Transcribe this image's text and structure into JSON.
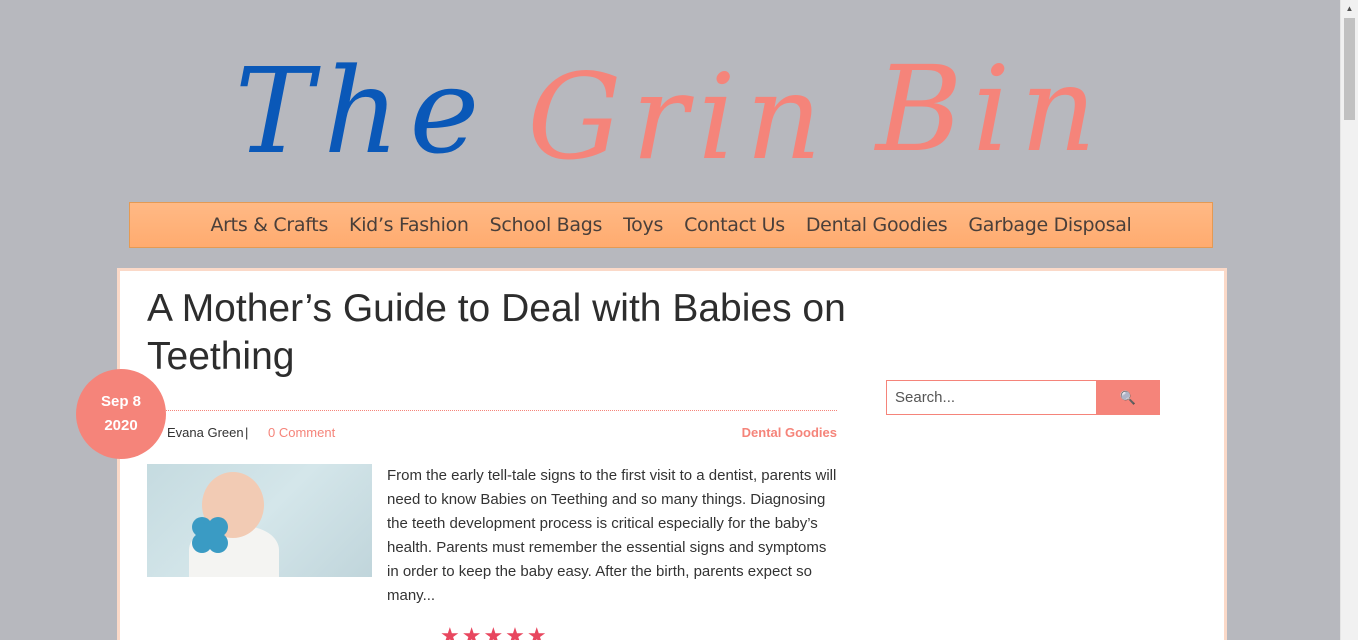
{
  "logo": {
    "word1": "The",
    "word2": "Grin",
    "word3": "Bin",
    "colors": {
      "primary": "#0a58b8",
      "accent": "#f5847a"
    }
  },
  "nav": {
    "items": [
      {
        "label": "Arts & Crafts"
      },
      {
        "label": "Kid’s Fashion"
      },
      {
        "label": "School Bags"
      },
      {
        "label": "Toys"
      },
      {
        "label": "Contact Us"
      },
      {
        "label": "Dental Goodies"
      },
      {
        "label": "Garbage Disposal"
      }
    ]
  },
  "post": {
    "title": "A Mother’s Guide to Deal with Babies on Teething",
    "date_line1": "Sep 8",
    "date_line2": "2020",
    "author": "Evana Green",
    "separator": "|",
    "comments": "0 Comment",
    "category": "Dental Goodies",
    "excerpt": "From the early tell-tale signs to the first visit to a dentist, parents will need to know Babies on Teething and so many things. Diagnosing the teeth development process is critical especially for the baby’s health. Parents must remember the essential signs and symptoms in order to keep the baby easy.  After the birth, parents expect so many...",
    "rating": "★★★★★"
  },
  "search": {
    "placeholder": "Search...",
    "icon": "search-icon",
    "button_symbol": "🔍"
  },
  "scrollbar": {
    "up_arrow": "▲"
  }
}
